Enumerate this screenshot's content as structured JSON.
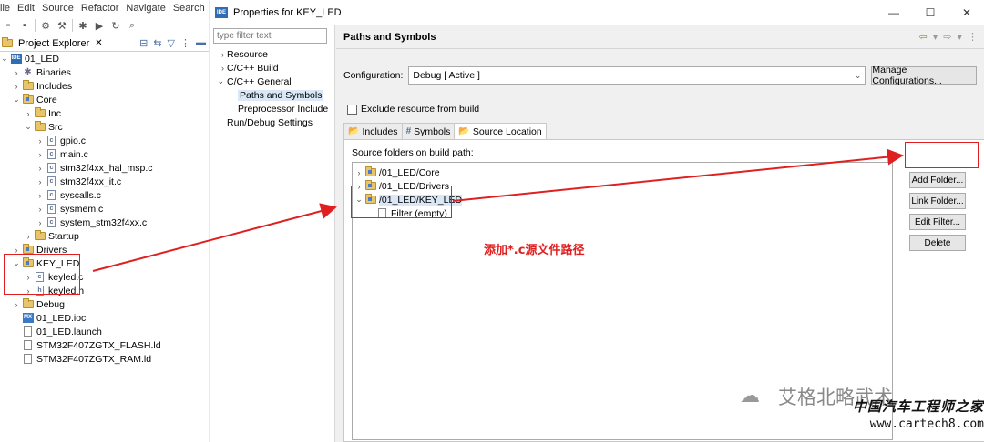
{
  "menu": [
    "ile",
    "Edit",
    "Source",
    "Refactor",
    "Navigate",
    "Search"
  ],
  "project_explorer": {
    "tab_label": "Project Explorer",
    "tree": [
      {
        "label": "01_LED",
        "level": 0,
        "icon": "project-icon",
        "expanded": true
      },
      {
        "label": "Binaries",
        "level": 1,
        "icon": "binaries-icon",
        "expanded": false
      },
      {
        "label": "Includes",
        "level": 1,
        "icon": "includes-icon",
        "expanded": false
      },
      {
        "label": "Core",
        "level": 1,
        "icon": "source-folder-icon",
        "expanded": true
      },
      {
        "label": "Inc",
        "level": 2,
        "icon": "folder-icon",
        "expanded": false
      },
      {
        "label": "Src",
        "level": 2,
        "icon": "folder-icon",
        "expanded": true
      },
      {
        "label": "gpio.c",
        "level": 3,
        "icon": "c-file-icon",
        "expanded": false
      },
      {
        "label": "main.c",
        "level": 3,
        "icon": "c-file-icon",
        "expanded": false
      },
      {
        "label": "stm32f4xx_hal_msp.c",
        "level": 3,
        "icon": "c-file-icon",
        "expanded": false
      },
      {
        "label": "stm32f4xx_it.c",
        "level": 3,
        "icon": "c-file-icon",
        "expanded": false
      },
      {
        "label": "syscalls.c",
        "level": 3,
        "icon": "c-file-icon",
        "expanded": false
      },
      {
        "label": "sysmem.c",
        "level": 3,
        "icon": "c-file-icon",
        "expanded": false
      },
      {
        "label": "system_stm32f4xx.c",
        "level": 3,
        "icon": "c-file-icon",
        "expanded": false
      },
      {
        "label": "Startup",
        "level": 2,
        "icon": "folder-icon",
        "expanded": false
      },
      {
        "label": "Drivers",
        "level": 1,
        "icon": "source-folder-icon",
        "expanded": false
      },
      {
        "label": "KEY_LED",
        "level": 1,
        "icon": "source-folder-icon",
        "expanded": true
      },
      {
        "label": "keyled.c",
        "level": 2,
        "icon": "c-file-icon",
        "expanded": false
      },
      {
        "label": "keyled.h",
        "level": 2,
        "icon": "h-file-icon",
        "expanded": false
      },
      {
        "label": "Debug",
        "level": 1,
        "icon": "folder-icon",
        "expanded": false
      },
      {
        "label": "01_LED.ioc",
        "level": 1,
        "icon": "mx-file-icon",
        "expanded": null
      },
      {
        "label": "01_LED.launch",
        "level": 1,
        "icon": "launch-file-icon",
        "expanded": null
      },
      {
        "label": "STM32F407ZGTX_FLASH.ld",
        "level": 1,
        "icon": "ld-file-icon",
        "expanded": null
      },
      {
        "label": "STM32F407ZGTX_RAM.ld",
        "level": 1,
        "icon": "ld-file-icon",
        "expanded": null
      }
    ]
  },
  "dialog": {
    "title": "Properties for KEY_LED",
    "filter_placeholder": "type filter text",
    "nav": [
      {
        "label": "Resource",
        "level": 0,
        "expanded": false
      },
      {
        "label": "C/C++ Build",
        "level": 0,
        "expanded": false
      },
      {
        "label": "C/C++ General",
        "level": 0,
        "expanded": true
      },
      {
        "label": "Paths and Symbols",
        "level": 1,
        "expanded": null,
        "selected": true
      },
      {
        "label": "Preprocessor Include",
        "level": 1,
        "expanded": null
      },
      {
        "label": "Run/Debug Settings",
        "level": 0,
        "expanded": null
      }
    ],
    "page_title": "Paths and Symbols",
    "configuration_label": "Configuration:",
    "configuration_value": "Debug  [ Active ]",
    "manage_button": "Manage Configurations...",
    "exclude_label": "Exclude resource from build",
    "tabs": [
      {
        "label": "Includes",
        "icon": "includes-tab-icon",
        "glyph": "📂",
        "active": false
      },
      {
        "label": "Symbols",
        "icon": "hash-icon",
        "glyph": "#",
        "active": false
      },
      {
        "label": "Source Location",
        "icon": "source-location-icon",
        "glyph": "📂",
        "active": true
      }
    ],
    "source_folders_label": "Source folders on build path:",
    "source_folders": [
      {
        "label": "/01_LED/Core",
        "level": 0,
        "expanded": false
      },
      {
        "label": "/01_LED/Drivers",
        "level": 0,
        "expanded": false
      },
      {
        "label": "/01_LED/KEY_LED",
        "level": 0,
        "expanded": true
      },
      {
        "label": "Filter (empty)",
        "level": 1,
        "expanded": null
      }
    ],
    "buttons": {
      "add_folder": "Add Folder...",
      "link_folder": "Link Folder...",
      "edit_filter": "Edit Filter...",
      "delete": "Delete"
    }
  },
  "annotation": "添加*.c源文件路径",
  "watermark": "艾格北略武术",
  "footer": {
    "site_name_cn": "中国汽车工程师之家",
    "url": "www.cartech8.com"
  },
  "colors": {
    "annotation_red": "#e02020",
    "selection": "#d9e7f7",
    "folder": "#e8c46a"
  }
}
